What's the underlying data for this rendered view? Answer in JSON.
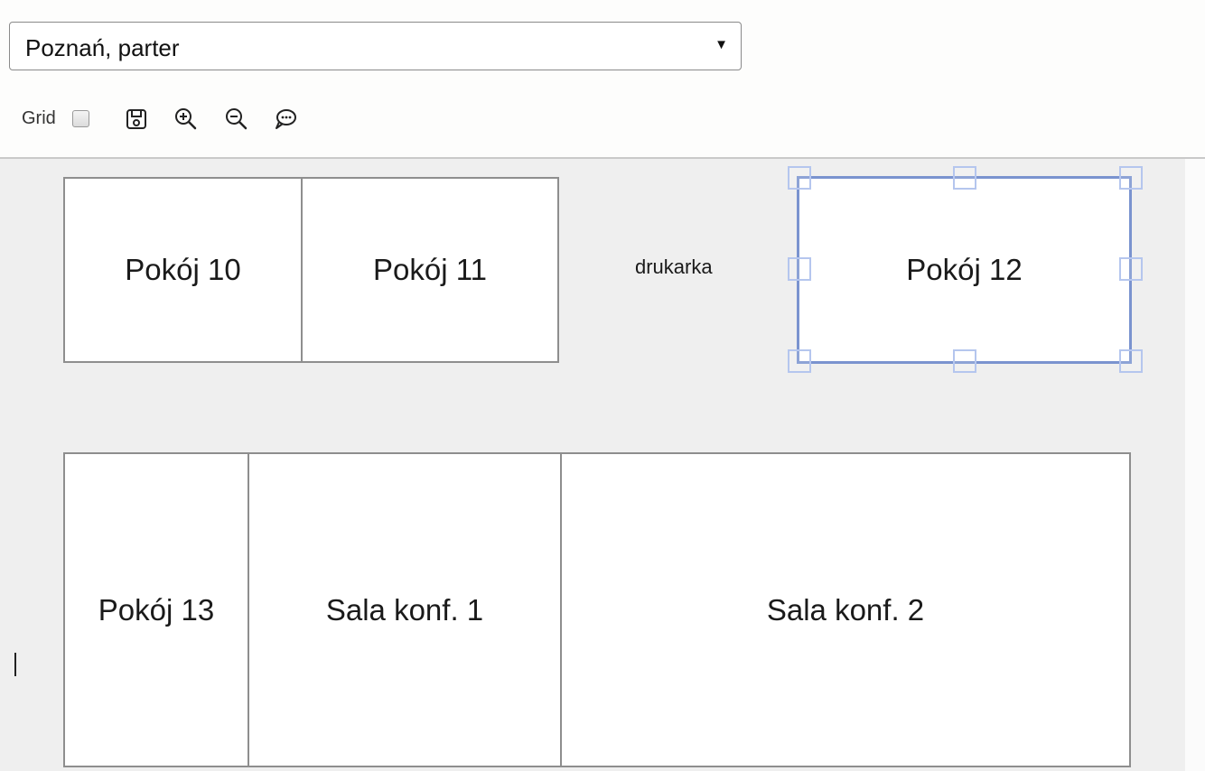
{
  "floor_select": {
    "value": "Poznań, parter",
    "caret": "▼"
  },
  "toolbar": {
    "grid_label": "Grid",
    "grid_checked": false,
    "icons": [
      "save-icon",
      "zoom-in-icon",
      "zoom-out-icon",
      "comment-icon"
    ]
  },
  "plan": {
    "rooms": [
      {
        "id": "pokoj-10",
        "label": "Pokój 10"
      },
      {
        "id": "pokoj-11",
        "label": "Pokój 11"
      },
      {
        "id": "pokoj-12",
        "label": "Pokój 12",
        "selected": true
      },
      {
        "id": "pokoj-13",
        "label": "Pokój 13"
      },
      {
        "id": "sala-konf-1",
        "label": "Sala konf. 1"
      },
      {
        "id": "sala-konf-2",
        "label": "Sala konf. 2"
      }
    ],
    "labels": [
      {
        "id": "drukarka",
        "text": "drukarka"
      }
    ]
  },
  "colors": {
    "selection_border": "#7a93cf",
    "selection_handle": "#b5c6ee",
    "canvas_background": "#efefef"
  }
}
